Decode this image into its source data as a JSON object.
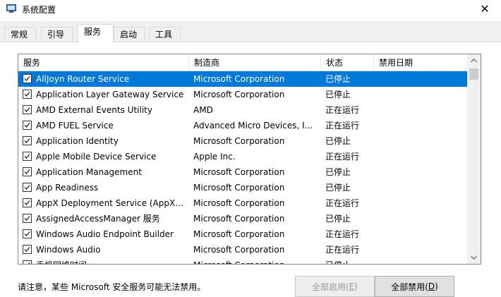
{
  "window": {
    "title": "系统配置",
    "close_glyph": "✕"
  },
  "tabs": [
    {
      "label": "常规"
    },
    {
      "label": "引导"
    },
    {
      "label": "服务"
    },
    {
      "label": "启动"
    },
    {
      "label": "工具"
    }
  ],
  "active_tab": "服务",
  "table": {
    "columns": [
      "服务",
      "制造商",
      "状态",
      "禁用日期"
    ],
    "rows": [
      {
        "service": "AllJoyn Router Service",
        "manufacturer": "Microsoft Corporation",
        "status": "已停止",
        "disabled_date": "",
        "checked": true,
        "selected": true
      },
      {
        "service": "Application Layer Gateway Service",
        "manufacturer": "Microsoft Corporation",
        "status": "已停止",
        "disabled_date": "",
        "checked": true
      },
      {
        "service": "AMD External Events Utility",
        "manufacturer": "AMD",
        "status": "正在运行",
        "disabled_date": "",
        "checked": true
      },
      {
        "service": "AMD FUEL Service",
        "manufacturer": "Advanced Micro Devices, I...",
        "status": "正在运行",
        "disabled_date": "",
        "checked": true
      },
      {
        "service": "Application Identity",
        "manufacturer": "Microsoft Corporation",
        "status": "已停止",
        "disabled_date": "",
        "checked": true
      },
      {
        "service": "Apple Mobile Device Service",
        "manufacturer": "Apple Inc.",
        "status": "正在运行",
        "disabled_date": "",
        "checked": true
      },
      {
        "service": "Application Management",
        "manufacturer": "Microsoft Corporation",
        "status": "已停止",
        "disabled_date": "",
        "checked": true
      },
      {
        "service": "App Readiness",
        "manufacturer": "Microsoft Corporation",
        "status": "已停止",
        "disabled_date": "",
        "checked": true
      },
      {
        "service": "AppX Deployment Service (AppX...",
        "manufacturer": "Microsoft Corporation",
        "status": "正在运行",
        "disabled_date": "",
        "checked": true
      },
      {
        "service": "AssignedAccessManager 服务",
        "manufacturer": "Microsoft Corporation",
        "status": "已停止",
        "disabled_date": "",
        "checked": true
      },
      {
        "service": "Windows Audio Endpoint Builder",
        "manufacturer": "Microsoft Corporation",
        "status": "正在运行",
        "disabled_date": "",
        "checked": true
      },
      {
        "service": "Windows Audio",
        "manufacturer": "Microsoft Corporation",
        "status": "正在运行",
        "disabled_date": "",
        "checked": true
      },
      {
        "service": "手机网络时间",
        "manufacturer": "Microsoft Corporation",
        "status": "已停止",
        "disabled_date": "",
        "checked": true
      }
    ]
  },
  "footer": {
    "note": "请注意，某些 Microsoft 安全服务可能无法禁用。",
    "enable_all_prefix": "全部启用(",
    "enable_all_key": "E",
    "enable_all_suffix": ")",
    "disable_all_prefix": "全部禁用(",
    "disable_all_key": "D",
    "disable_all_suffix": ")"
  },
  "colors": {
    "selection": "#0078d7",
    "disabled_text": "#9a9a9a"
  },
  "icons": {
    "app": "msconfig-icon",
    "check": "check-icon",
    "scroll_up": "chevron-up-icon",
    "scroll_down": "chevron-down-icon"
  }
}
